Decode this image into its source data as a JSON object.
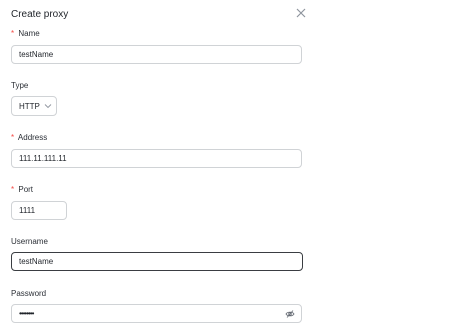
{
  "dialog": {
    "title": "Create proxy"
  },
  "fields": {
    "name": {
      "label": "Name",
      "required": "*",
      "value": "testName"
    },
    "type": {
      "label": "Type",
      "value": "HTTP"
    },
    "address": {
      "label": "Address",
      "required": "*",
      "value": "111.11.111.11"
    },
    "port": {
      "label": "Port",
      "required": "*",
      "value": "1111"
    },
    "username": {
      "label": "Username",
      "value": "testName"
    },
    "password": {
      "label": "Password",
      "value": "••••••••"
    }
  },
  "icons": {
    "close": "close-icon",
    "chevron": "chevron-down-icon",
    "eye": "eye-off-icon"
  }
}
